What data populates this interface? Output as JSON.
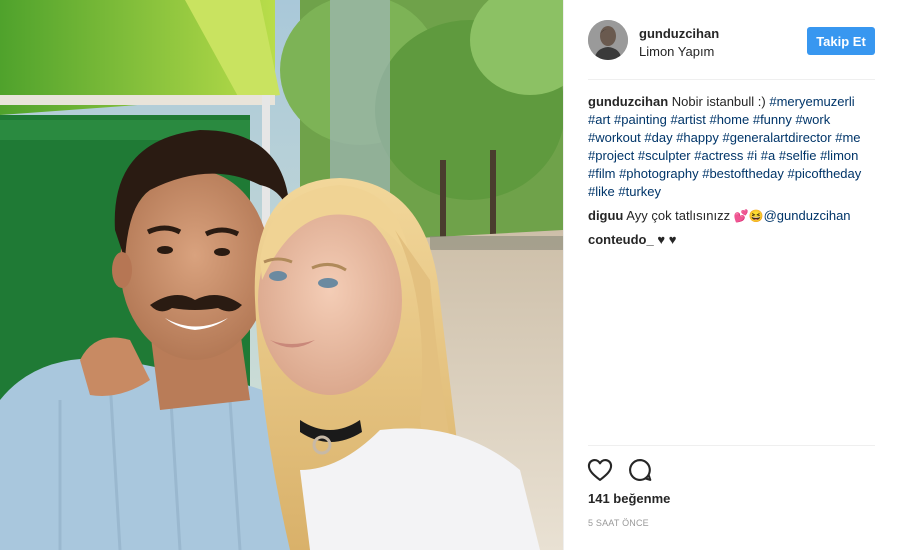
{
  "post": {
    "username": "gunduzcihan",
    "location": "Limon Yapım",
    "follow_label": "Takip Et",
    "caption": {
      "username": "gunduzcihan",
      "text": "Nobir istanbull :)",
      "hashtags": [
        "#meryemuzerli",
        "#art",
        "#painting",
        "#artist",
        "#home",
        "#funny",
        "#work",
        "#workout",
        "#day",
        "#happy",
        "#generalartdirector",
        "#me",
        "#project",
        "#sculpter",
        "#actress",
        "#i",
        "#a",
        "#selfie",
        "#limon",
        "#film",
        "#photography",
        "#bestoftheday",
        "#picoftheday",
        "#like",
        "#turkey"
      ]
    },
    "comments": [
      {
        "username": "diguu",
        "text": "Ayy çok tatlısınızz",
        "emoji": "💕😆",
        "mention": "@gunduzcihan"
      },
      {
        "username": "conteudo_",
        "text": "♥ ♥"
      }
    ],
    "likes_text": "141 beğenme",
    "time_text": "5 SAAT ÖNCE",
    "icons": {
      "like": "heart-outline-icon",
      "comment": "speech-bubble-icon"
    },
    "colors": {
      "follow_button": "#3897f0",
      "hashtag": "#003569",
      "muted": "#999999"
    }
  }
}
